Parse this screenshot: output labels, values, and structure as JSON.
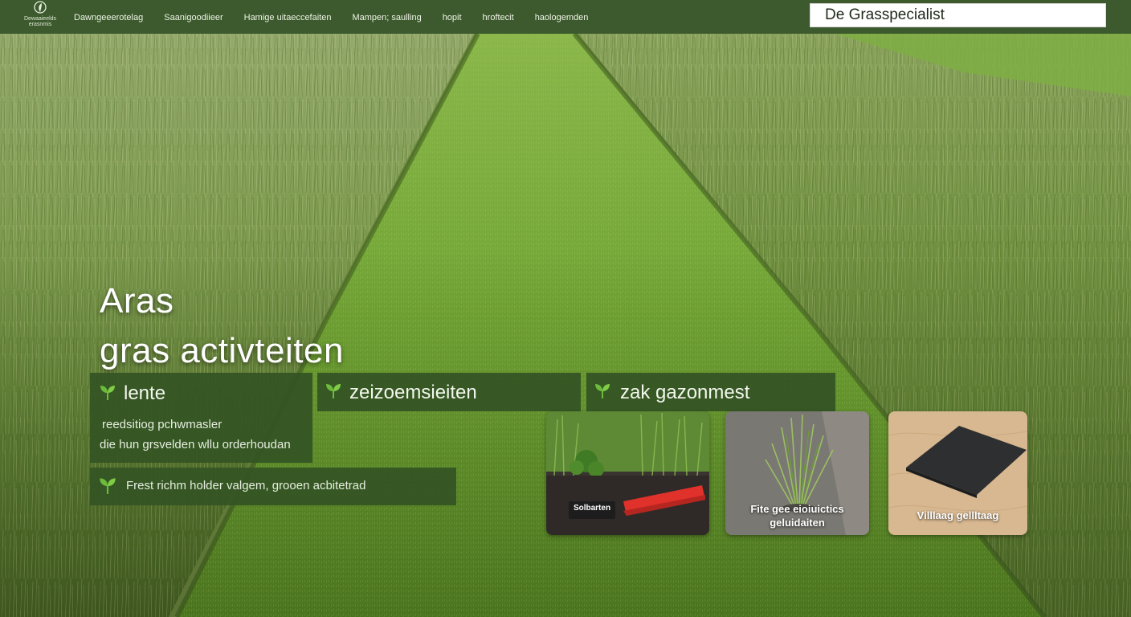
{
  "header": {
    "logo_text": "Dewaaieelds erasnmis",
    "nav": [
      "Dawngeeerotelag",
      "Saanigoodiieer",
      "Hamige uitaeccefaiten",
      "Mampen; saulling",
      "hopit",
      "hroftecit",
      "haologemden"
    ],
    "search_value": "De Grasspecialist"
  },
  "hero": {
    "title_line1": "Aras",
    "title_line2": "gras activteiten"
  },
  "tabs": [
    {
      "label": "lente",
      "icon": "leaf-icon"
    },
    {
      "label": "zeizoemsieiten",
      "icon": "leaf-icon"
    },
    {
      "label": "zak gazonmest",
      "icon": "leaf-icon"
    }
  ],
  "lente_panel": {
    "line1": "reedsitiog pchwmasler",
    "line2": "die hun grsvelden wllu orderhoudan"
  },
  "tip_bar": {
    "text": "Frest richm holder valgem, grooen acbitetrad"
  },
  "products": [
    {
      "label": "Solbarten",
      "caption": ""
    },
    {
      "label": "",
      "caption": "Fite gee eioiuictics geluidaiten"
    },
    {
      "label": "",
      "caption": "Villlaag gellltaag"
    }
  ],
  "colors": {
    "nav_bg": "#3c5a2d",
    "panel_bg": "#345424",
    "leaf": "#6dbb3c",
    "accent_red": "#e0312a"
  }
}
